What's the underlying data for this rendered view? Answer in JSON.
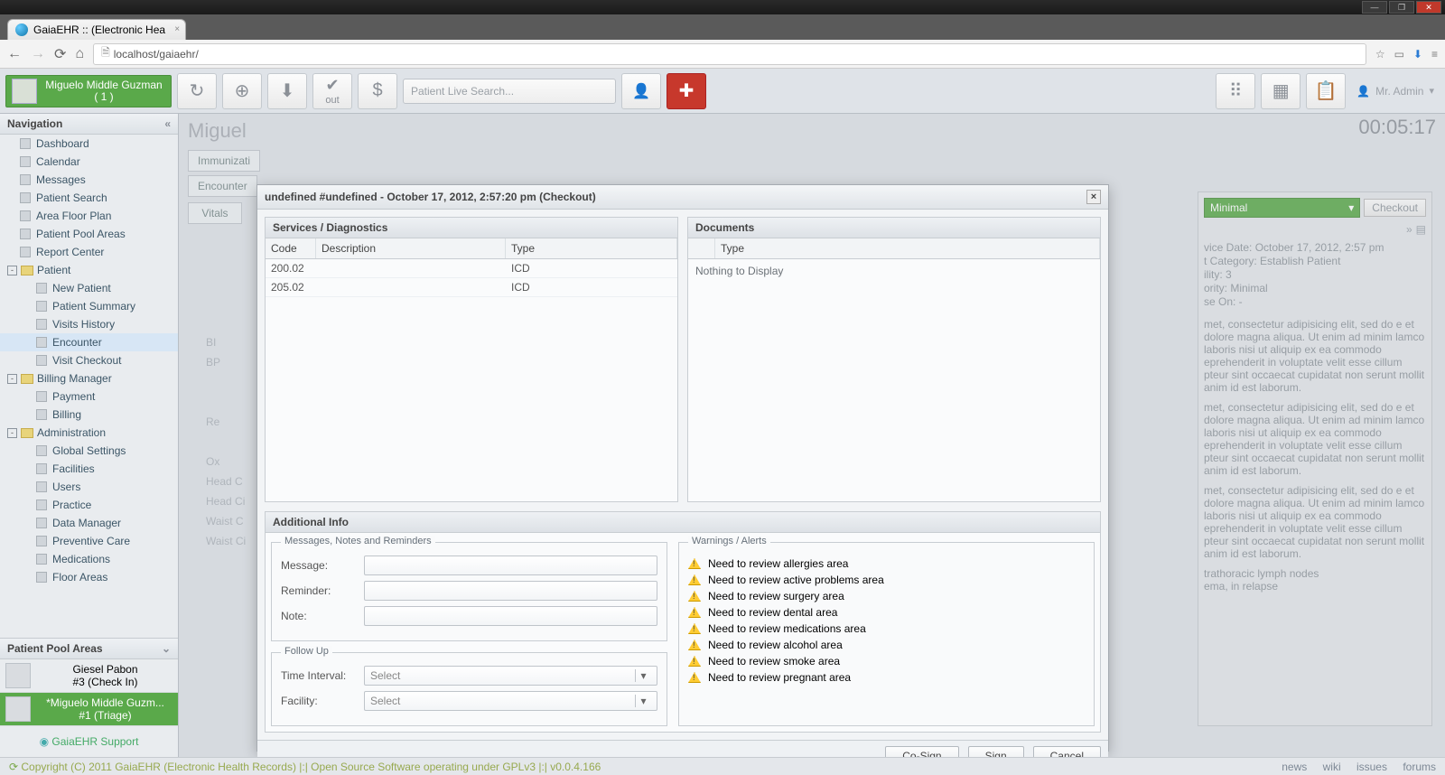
{
  "os_window": {
    "minimize": "—",
    "maximize": "❐",
    "close": "✕"
  },
  "browser": {
    "tab_title": "GaiaEHR :: (Electronic Hea",
    "url": "localhost/gaiaehr/"
  },
  "header": {
    "patient_name": "Miguelo Middle Guzman",
    "patient_count": "( 1 )",
    "search_placeholder": "Patient Live Search...",
    "admin_label": "Mr. Admin"
  },
  "timer": "00:05:17",
  "nav": {
    "title": "Navigation",
    "items": [
      "Dashboard",
      "Calendar",
      "Messages",
      "Patient Search",
      "Area Floor Plan",
      "Patient Pool Areas",
      "Report Center"
    ],
    "patient_folder": "Patient",
    "patient_items": [
      "New Patient",
      "Patient Summary",
      "Visits History",
      "Encounter",
      "Visit Checkout"
    ],
    "billing_folder": "Billing Manager",
    "billing_items": [
      "Payment",
      "Billing"
    ],
    "admin_folder": "Administration",
    "admin_items": [
      "Global Settings",
      "Facilities",
      "Users",
      "Practice",
      "Data Manager",
      "Preventive Care",
      "Medications",
      "Floor Areas"
    ],
    "pool_title": "Patient Pool Areas",
    "pool": [
      {
        "name": "Giesel Pabon",
        "sub": "#3 (Check In)"
      },
      {
        "name": "*Miguelo Middle Guzm...",
        "sub": "#1 (Triage)"
      }
    ],
    "support": "GaiaEHR Support"
  },
  "background": {
    "page_heading": "Miguel",
    "tabs": [
      "Immunizati",
      "Encounter"
    ],
    "vitals": "Vitals",
    "labels": [
      "BI",
      "BP",
      "",
      "",
      "Re",
      "",
      "Ox",
      "Head C",
      "Head Ci",
      "Waist C",
      "Waist Ci"
    ]
  },
  "right": {
    "priority_selected": "Minimal",
    "checkout_btn": "Checkout",
    "meta": [
      "vice Date: October 17, 2012, 2:57 pm",
      "t Category: Establish Patient",
      "ility: 3",
      "ority: Minimal",
      "se On: -"
    ],
    "lorem": "met, consectetur adipisicing elit, sed do e et dolore magna aliqua. Ut enim ad minim lamco laboris nisi ut aliquip ex ea commodo eprehenderit in voluptate velit esse cillum pteur sint occaecat cupidatat non serunt mollit anim id est laborum.",
    "diag": [
      "trathoracic lymph nodes",
      "ema, in relapse"
    ]
  },
  "modal": {
    "title": "undefined #undefined - October 17, 2012, 2:57:20 pm (Checkout)",
    "services_title": "Services / Diagnostics",
    "documents_title": "Documents",
    "svc_cols": {
      "code": "Code",
      "desc": "Description",
      "type": "Type"
    },
    "doc_cols": {
      "blank": "",
      "type": "Type"
    },
    "services": [
      {
        "code": "200.02",
        "desc": "",
        "type": "ICD"
      },
      {
        "code": "205.02",
        "desc": "",
        "type": "ICD"
      }
    ],
    "documents_empty": "Nothing to Display",
    "additional_title": "Additional Info",
    "fs_messages": "Messages, Notes and Reminders",
    "fs_followup": "Follow Up",
    "fs_warnings": "Warnings / Alerts",
    "labels": {
      "message": "Message:",
      "reminder": "Reminder:",
      "note": "Note:",
      "time_interval": "Time Interval:",
      "facility": "Facility:"
    },
    "select_placeholder": "Select",
    "warnings": [
      "Need to review allergies area",
      "Need to review active problems area",
      "Need to review surgery area",
      "Need to review dental area",
      "Need to review medications area",
      "Need to review alcohol area",
      "Need to review smoke area",
      "Need to review pregnant area"
    ],
    "buttons": {
      "cosign": "Co-Sign",
      "sign": "Sign",
      "cancel": "Cancel"
    }
  },
  "status": {
    "copyright": "Copyright (C) 2011 GaiaEHR (Electronic Health Records) |:| Open Source Software operating under GPLv3 |:| v0.0.4.166",
    "links": [
      "news",
      "wiki",
      "issues",
      "forums"
    ]
  }
}
